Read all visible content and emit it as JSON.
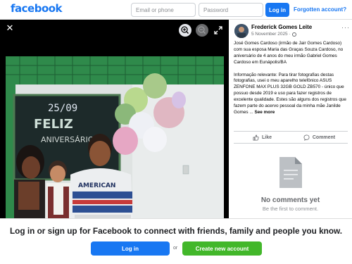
{
  "nav": {
    "logo": "facebook",
    "email_placeholder": "Email or phone",
    "password_placeholder": "Password",
    "login_label": "Log in",
    "forgot_label": "Forgotten account?"
  },
  "viewer": {
    "close_icon": "close-icon",
    "zoom_in_icon": "zoom-in-icon",
    "zoom_out_icon": "zoom-out-icon",
    "expand_icon": "expand-icon",
    "chalkboard_text": [
      "25/09",
      "FELIZ",
      "ANIVERSÁRIO"
    ],
    "shirt_text": "AMERICAN"
  },
  "post": {
    "author": "Frederick Gomes Leite",
    "date": "5 November 2025",
    "separator": "·",
    "caption_p1": "José Gomes Cardoso (irmão de Jair Gomes Cardoso) com sua esposa Maria das Graças Souza Cardoso, no aniversário de 4 anos do meu irmão Gabriel Gomes Cardoso em Eunápolis/BA",
    "caption_p2": "Informação relevante: Para tirar fotografias destas fotografias, usei o meu aparelho telefônico ASUS ZENFONE MAX PLUS 32GB GOLD ZB570 - único que possuo desde 2019 e uso para fazer registros de excelente qualidade. Estes são alguns dos registros que fazem parte do acervo pessoal da minha mãe Janilde Gomes ...",
    "see_more": "See more",
    "like_label": "Like",
    "comment_label": "Comment",
    "no_comments_title": "No comments yet",
    "no_comments_sub": "Be the first to comment."
  },
  "bottom": {
    "cta": "Log in or sign up for Facebook to connect with friends, family and people you know.",
    "login_label": "Log in",
    "or_label": "or",
    "create_label": "Create new account"
  },
  "colors": {
    "brand": "#1877f2",
    "create": "#42b72a"
  }
}
